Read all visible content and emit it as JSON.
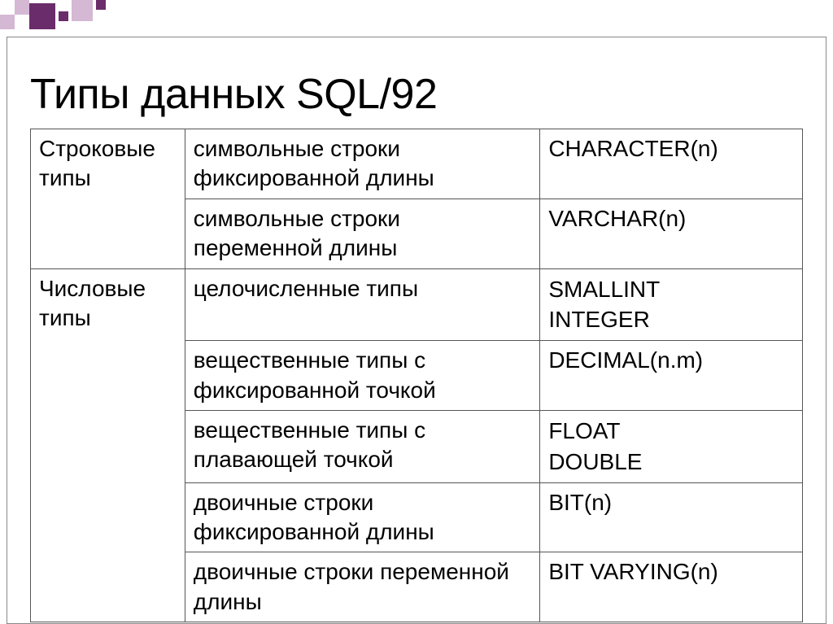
{
  "title": "Типы данных SQL/92",
  "rows": [
    {
      "c1": "Строковые типы",
      "c2": "символьные строки фиксированной длины",
      "c3a": "CHARACTER(n)",
      "rowspan1": 2
    },
    {
      "c1": "",
      "c2": "символьные строки переменной длины",
      "c3a": "VARCHAR(n)"
    },
    {
      "c1": "Числовые типы",
      "c2": "целочисленные типы",
      "c3a": "SMALLINT",
      "c3b": "INTEGER",
      "rowspan1": 5
    },
    {
      "c1": "",
      "c2": "вещественные типы с фиксированной точкой",
      "c3a": "DECIMAL(n.m)"
    },
    {
      "c1": "",
      "c2": "вещественные типы с плавающей точкой",
      "c3a": "FLOAT",
      "c3b": "DOUBLE"
    },
    {
      "c1": "",
      "c2": "двоичные строки фиксированной длины",
      "c3a": "BIT(n)"
    },
    {
      "c1": "",
      "c2": "двоичные строки переменной длины",
      "c3a": "BIT VARYING(n)"
    }
  ]
}
